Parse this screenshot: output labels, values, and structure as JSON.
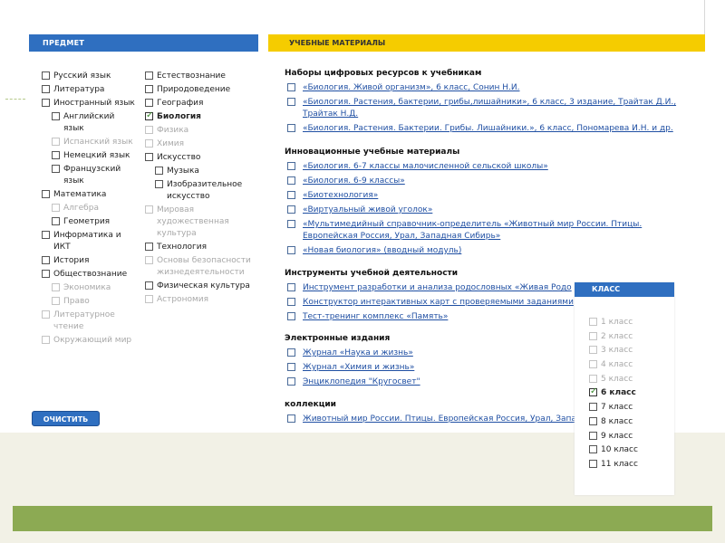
{
  "subject_panel": {
    "header": "ПРЕДМЕТ",
    "col1": [
      {
        "label": "Русский язык",
        "state": "normal",
        "indent": 0
      },
      {
        "label": "Литература",
        "state": "normal",
        "indent": 0
      },
      {
        "label": "Иностранный язык",
        "state": "normal",
        "indent": 0
      },
      {
        "label": "Английский язык",
        "state": "normal",
        "indent": 1
      },
      {
        "label": "Испанский язык",
        "state": "disabled",
        "indent": 1
      },
      {
        "label": "Немецкий язык",
        "state": "normal",
        "indent": 1
      },
      {
        "label": "Французский язык",
        "state": "normal",
        "indent": 1
      },
      {
        "label": "Математика",
        "state": "normal",
        "indent": 0
      },
      {
        "label": "Алгебра",
        "state": "disabled",
        "indent": 1
      },
      {
        "label": "Геометрия",
        "state": "normal",
        "indent": 1
      },
      {
        "label": "Информатика и ИКТ",
        "state": "normal",
        "indent": 0
      },
      {
        "label": "История",
        "state": "normal",
        "indent": 0
      },
      {
        "label": "Обществознание",
        "state": "normal",
        "indent": 0
      },
      {
        "label": "Экономика",
        "state": "disabled",
        "indent": 1
      },
      {
        "label": "Право",
        "state": "disabled",
        "indent": 1
      },
      {
        "label": "Литературное чтение",
        "state": "disabled",
        "indent": 0
      },
      {
        "label": "Окружающий мир",
        "state": "disabled",
        "indent": 0
      }
    ],
    "col2": [
      {
        "label": "Естествознание",
        "state": "normal",
        "indent": 0
      },
      {
        "label": "Природоведение",
        "state": "normal",
        "indent": 0
      },
      {
        "label": "География",
        "state": "normal",
        "indent": 0
      },
      {
        "label": "Биология",
        "state": "checked",
        "indent": 0
      },
      {
        "label": "Физика",
        "state": "disabled",
        "indent": 0
      },
      {
        "label": "Химия",
        "state": "disabled",
        "indent": 0
      },
      {
        "label": "Искусство",
        "state": "normal",
        "indent": 0
      },
      {
        "label": "Музыка",
        "state": "normal",
        "indent": 1
      },
      {
        "label": "Изобразительное искусство",
        "state": "normal",
        "indent": 1
      },
      {
        "label": "Мировая художественная культура",
        "state": "disabled",
        "indent": 0
      },
      {
        "label": "Технология",
        "state": "normal",
        "indent": 0
      },
      {
        "label": "Основы безопасности жизнедеятельности",
        "state": "disabled",
        "indent": 0
      },
      {
        "label": "Физическая культура",
        "state": "normal",
        "indent": 0
      },
      {
        "label": "Астрономия",
        "state": "disabled",
        "indent": 0
      }
    ],
    "clear_button": "ОЧИСТИТЬ"
  },
  "materials_panel": {
    "header": "УЧЕБНЫЕ МАТЕРИАЛЫ",
    "sections": [
      {
        "title": "Наборы цифровых ресурсов к учебникам",
        "items": [
          "«Биология. Живой организм», 6 класс, Сонин Н.И.",
          "«Биология. Растения, бактерии, грибы,лишайники», 6 класс, 3 издание, Трайтак Д.И., Трайтак Н.Д.",
          "«Биология. Растения. Бактерии. Грибы. Лишайники.», 6 класс, Пономарева И.Н. и др."
        ]
      },
      {
        "title": "Инновационные учебные материалы",
        "items": [
          "«Биология. 6-7 классы малочисленной сельской школы»",
          "«Биология. 6-9 классы»",
          "«Биотехнология»",
          "«Виртуальный живой уголок»",
          "«Мультимедийный справочник-определитель «Животный мир России. Птицы. Европейская Россия, Урал, Западная Сибирь»",
          "«Новая биология» (вводный модуль)"
        ]
      },
      {
        "title": "Инструменты учебной деятельности",
        "items": [
          "Инструмент разработки и анализа родословных «Живая Родо",
          "Конструктор интерактивных карт с проверяемыми заданиями",
          "Тест-тренинг комплекс «Память»"
        ]
      },
      {
        "title": "Электронные издания",
        "items": [
          "Журнал «Наука и жизнь»",
          "Журнал «Химия и жизнь»",
          "Энциклопедия \"Кругосвет\""
        ]
      },
      {
        "title": "коллекции",
        "items": [
          "Животный мир России. Птицы. Европейская Россия, Урал, Запа"
        ]
      }
    ]
  },
  "class_popup": {
    "header": "КЛАСС",
    "items": [
      {
        "label": "1 класс",
        "state": "disabled"
      },
      {
        "label": "2 класс",
        "state": "disabled"
      },
      {
        "label": "3 класс",
        "state": "disabled"
      },
      {
        "label": "4 класс",
        "state": "disabled"
      },
      {
        "label": "5 класс",
        "state": "disabled"
      },
      {
        "label": "6 класс",
        "state": "checked"
      },
      {
        "label": "7 класс",
        "state": "normal"
      },
      {
        "label": "8 класс",
        "state": "normal"
      },
      {
        "label": "9 класс",
        "state": "normal"
      },
      {
        "label": "10 класс",
        "state": "normal"
      },
      {
        "label": "11 класс",
        "state": "normal"
      }
    ]
  },
  "colors": {
    "blue": "#2f6fc0",
    "yellow": "#f5cc00",
    "green": "#8caa53",
    "link": "#1f4fa3"
  }
}
